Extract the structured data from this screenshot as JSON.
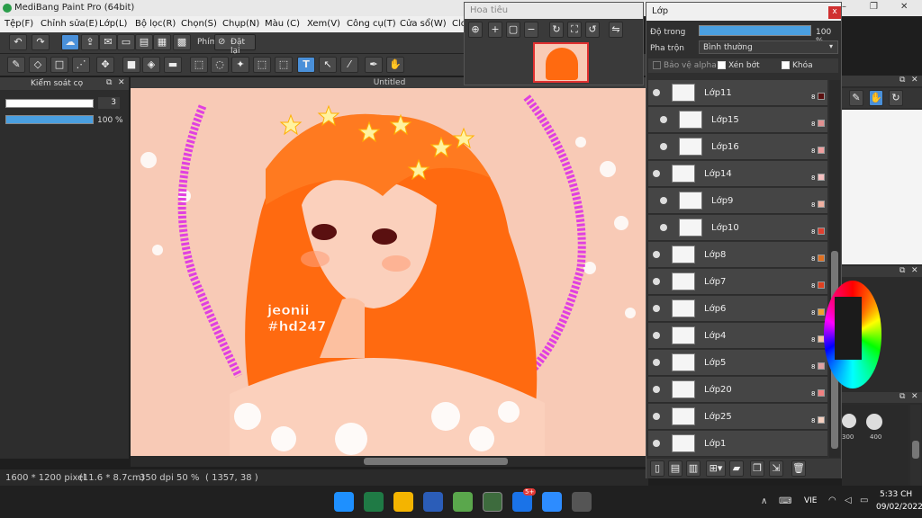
{
  "app": {
    "title": "MediBang Paint Pro (64bit)",
    "win_min": "–",
    "win_max": "❐",
    "win_close": "✕"
  },
  "menu": [
    "Tệp(F)",
    "Chỉnh sửa(E)",
    "Lớp(L)",
    "Bộ lọc(R)",
    "Chọn(S)",
    "Chụp(N)",
    "Màu (C)",
    "Xem(V)",
    "Công cụ(T)",
    "Cửa sổ(W)",
    "Clo"
  ],
  "toolbar": {
    "shortcut_label": "Phím",
    "reset_label": "Đặt lại"
  },
  "left_panel": {
    "title": "Kiểm soát cọ",
    "size_value": "3",
    "opacity_value": "100 %",
    "opacity_fraction": 1.0
  },
  "canvas": {
    "tab_title": "Untitled",
    "text_line1": "jeonii",
    "text_line2": "#hd247"
  },
  "status": {
    "size": "1600 * 1200 pixel",
    "physical": "(11.6 * 8.7cm)",
    "dpi": "350 dpi",
    "zoom": "50 %",
    "coords": "( 1357, 38 )"
  },
  "navigator": {
    "title": "Hoa tiêu"
  },
  "layers": {
    "title": "Lớp",
    "close": "x",
    "opacity_label": "Độ trong",
    "opacity_value": "100 %",
    "blend_label": "Pha trộn",
    "blend_value": "Bình thường",
    "protect_alpha": "Bảo vệ alpha",
    "clipping": "Xén bớt",
    "lock": "Khóa",
    "items": [
      {
        "name": "Lớp11",
        "indent": false,
        "badge": "8",
        "color": "#5a1010"
      },
      {
        "name": "Lớp15",
        "indent": true,
        "badge": "8",
        "color": "#e09090"
      },
      {
        "name": "Lớp16",
        "indent": true,
        "badge": "8",
        "color": "#f0a0a0"
      },
      {
        "name": "Lớp14",
        "indent": false,
        "badge": "8",
        "color": "#f5c0c0"
      },
      {
        "name": "Lớp9",
        "indent": true,
        "badge": "8",
        "color": "#f0b0a0"
      },
      {
        "name": "Lớp10",
        "indent": true,
        "badge": "8",
        "color": "#e04030"
      },
      {
        "name": "Lớp8",
        "indent": false,
        "badge": "8",
        "color": "#e07020"
      },
      {
        "name": "Lớp7",
        "indent": false,
        "badge": "8",
        "color": "#e04020"
      },
      {
        "name": "Lớp6",
        "indent": false,
        "badge": "8",
        "color": "#f0a030"
      },
      {
        "name": "Lớp4",
        "indent": false,
        "badge": "8",
        "color": "#f5c0a0"
      },
      {
        "name": "Lớp5",
        "indent": false,
        "badge": "8",
        "color": "#e0a0a0"
      },
      {
        "name": "Lớp20",
        "indent": false,
        "badge": "8",
        "color": "#f08080"
      },
      {
        "name": "Lớp25",
        "indent": false,
        "badge": "8",
        "color": "#f5d0c0"
      },
      {
        "name": "Lớp1",
        "indent": false,
        "badge": "",
        "color": ""
      }
    ]
  },
  "brushes": {
    "size_a": "300",
    "size_b": "400"
  },
  "taskbar": {
    "lang": "VIE",
    "time": "5:33 CH",
    "date": "09/02/2022",
    "zalo_badge": "5+"
  }
}
